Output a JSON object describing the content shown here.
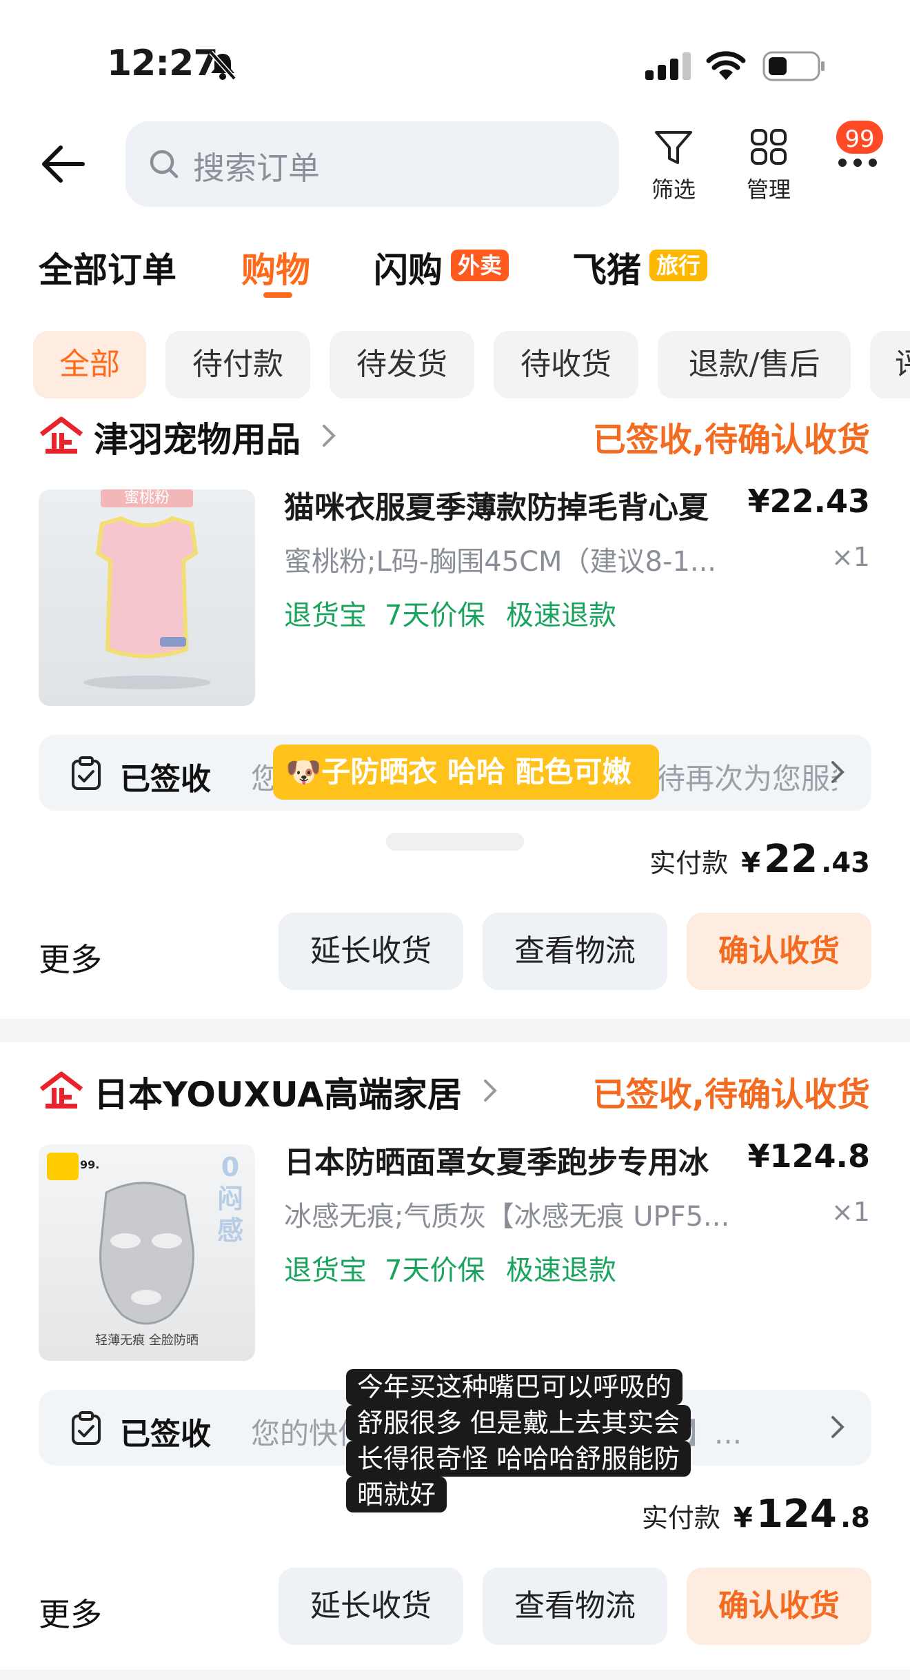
{
  "status_bar": {
    "time": "12:27"
  },
  "header": {
    "search_placeholder": "搜索订单",
    "filter_label": "筛选",
    "manage_label": "管理",
    "badge_count": "99"
  },
  "main_tabs": [
    {
      "label": "全部订单"
    },
    {
      "label": "购物"
    },
    {
      "label": "闪购",
      "tag": "外卖"
    },
    {
      "label": "飞猪",
      "tag": "旅行"
    }
  ],
  "filter_chips": [
    "全部",
    "待付款",
    "待发货",
    "待收货",
    "退款/售后",
    "评"
  ],
  "orders": [
    {
      "shop_name": "津羽宠物用品",
      "status": "已签收,待确认收货",
      "thumb_label": "蜜桃粉",
      "title": "猫咪衣服夏季薄款防掉毛背心夏",
      "price": "¥22.43",
      "sku": "蜜桃粉;L码-胸围45CM（建议8-1...",
      "qty": "×1",
      "services": [
        "退货宝",
        "7天价保",
        "极速退款"
      ],
      "logistics_label": "已签收",
      "logistics_text": "您的快件已签收，感谢使用，期待再次为您服务。如遇...",
      "paid_label": "实付款",
      "paid_currency": "¥",
      "paid_int": "22",
      "paid_dec": ".43",
      "more_label": "更多",
      "actions": [
        "延长收货",
        "查看物流",
        "确认收货"
      ]
    },
    {
      "shop_name": "日本YOUXUA高端家居",
      "status": "已签收,待确认收货",
      "thumb_label": "轻薄无痕 全脸防晒",
      "thumb_side": "0闷感",
      "thumb_badge": "99.",
      "title": "日本防晒面罩女夏季跑步专用冰",
      "price": "¥124.8",
      "sku": "冰感无痕;气质灰【冰感无痕 UPF5...",
      "qty": "×1",
      "services": [
        "退货宝",
        "7天价保",
        "极速退款"
      ],
      "logistics_label": "已签收",
      "logistics_text": "您的快件已存放至【快递驿站水池】...",
      "paid_label": "实付款",
      "paid_currency": "¥",
      "paid_int": "124",
      "paid_dec": ".8",
      "more_label": "更多",
      "actions": [
        "延长收货",
        "查看物流",
        "确认收货"
      ]
    }
  ],
  "overlays": {
    "sticker_emoji": "🐶",
    "sticker_text": "子防晒衣 哈哈 配色可嫩",
    "caption_lines": [
      "今年买这种嘴巴可以呼吸的",
      "舒服很多 但是戴上去其实会",
      "长得很奇怪 哈哈哈舒服能防",
      "晒就好"
    ]
  },
  "colors": {
    "accent": "#ff6a1a",
    "status_orange": "#f26b21",
    "service_green": "#1aa35c",
    "badge_red": "#ff4a25",
    "tag_orange": "#ff5a1f",
    "tag_yellow": "#ffb800"
  }
}
